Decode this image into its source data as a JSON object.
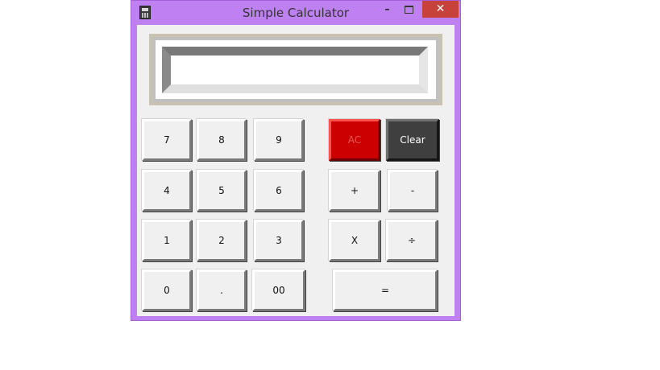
{
  "window": {
    "title": "Simple Calculator",
    "minimize_glyph": "–",
    "close_glyph": "✕",
    "app_icon": "calculator-icon"
  },
  "display": {
    "value": ""
  },
  "keys": {
    "k7": "7",
    "k8": "8",
    "k9": "9",
    "k4": "4",
    "k5": "5",
    "k6": "6",
    "k1": "1",
    "k2": "2",
    "k3": "3",
    "k0": "0",
    "dot": ".",
    "k00": "00",
    "ac": "AC",
    "clear": "Clear",
    "plus": "+",
    "minus": "-",
    "times": "X",
    "divide": "÷",
    "equals": "="
  },
  "colors": {
    "titlebar": "#bf80f2",
    "ac": "#cc0000",
    "clear": "#3f3f3f",
    "close": "#c7423b"
  }
}
